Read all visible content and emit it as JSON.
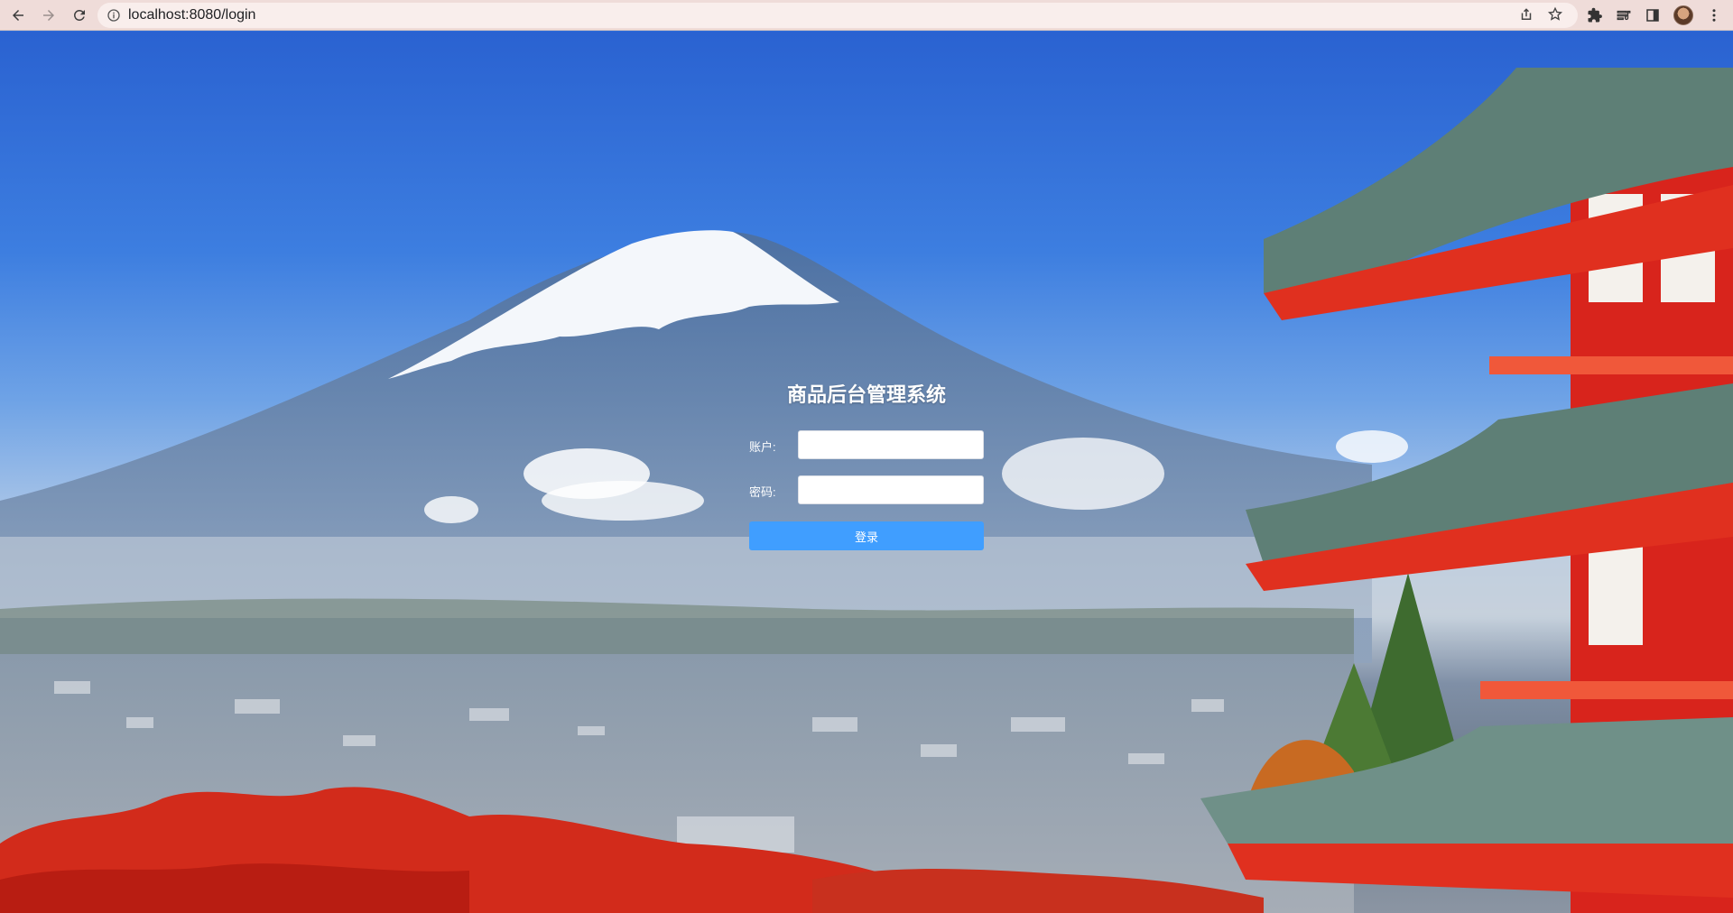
{
  "browser": {
    "url": "localhost:8080/login",
    "icons": [
      "back-icon",
      "forward-icon",
      "reload-icon",
      "site-info-icon",
      "share-icon",
      "star-icon",
      "extensions-icon",
      "reading-list-icon",
      "side-panel-icon",
      "menu-icon"
    ]
  },
  "login": {
    "title": "商品后台管理系统",
    "account_label": "账户:",
    "password_label": "密码:",
    "account_value": "",
    "password_value": "",
    "submit_label": "登录"
  },
  "colors": {
    "primary_button": "#409eff",
    "chrome_bar": "#efdcd9"
  }
}
